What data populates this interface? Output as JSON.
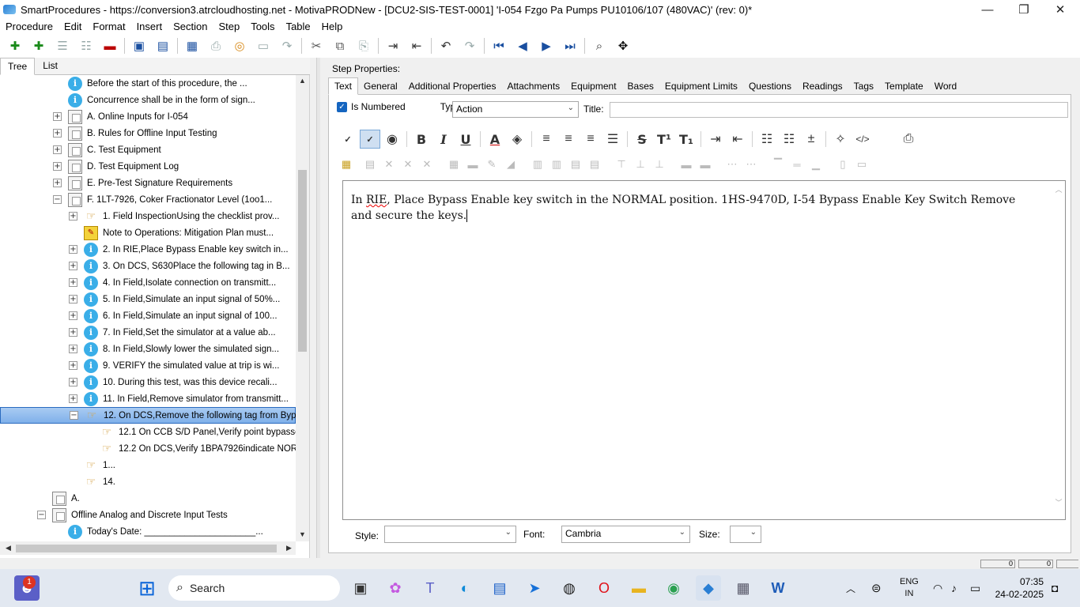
{
  "window": {
    "title": "SmartProcedures - https://conversion3.atrcloudhosting.net - MotivaPRODNew - [DCU2-SIS-TEST-0001] 'I-054 Fzgo Pa Pumps PU10106/107 (480VAC)' (rev: 0)*",
    "minimize": "—",
    "maximize": "❐",
    "close": "✕"
  },
  "menu": [
    "Procedure",
    "Edit",
    "Format",
    "Insert",
    "Section",
    "Step",
    "Tools",
    "Table",
    "Help"
  ],
  "toolbar_icons": [
    "add-icon",
    "add-sub-icon",
    "list-icon",
    "list-gray-icon",
    "remove-icon",
    "save-all-icon",
    "save-icon",
    "export-icon",
    "print-icon",
    "link-icon",
    "blank-icon",
    "redo-gray-icon",
    "cut-icon",
    "copy-icon",
    "paste-icon",
    "indent-icon",
    "outdent-icon",
    "undo-icon",
    "redo-icon",
    "first-icon",
    "prev-icon",
    "next-icon",
    "last-icon",
    "find-icon",
    "move-icon"
  ],
  "left": {
    "tabs": [
      "Tree",
      "List"
    ],
    "tree": [
      {
        "expander": "",
        "icon": "info",
        "label": "Before the start of this procedure, the ...",
        "indent": 1
      },
      {
        "expander": "",
        "icon": "info",
        "label": "Concurrence shall be in the form of sign...",
        "indent": 1
      },
      {
        "expander": "+",
        "icon": "doc",
        "label": "A. Online Inputs for I-054",
        "indent": 1
      },
      {
        "expander": "+",
        "icon": "doc",
        "label": "B. Rules for Offline Input Testing",
        "indent": 1
      },
      {
        "expander": "+",
        "icon": "doc",
        "label": "C. Test Equipment",
        "indent": 1
      },
      {
        "expander": "+",
        "icon": "doc",
        "label": "D. Test Equipment Log",
        "indent": 1
      },
      {
        "expander": "+",
        "icon": "doc",
        "label": "E. Pre-Test Signature Requirements",
        "indent": 1
      },
      {
        "expander": "−",
        "icon": "doc",
        "label": "F. 1LT-7926, Coker Fractionator Level (1oo1...",
        "indent": 1
      },
      {
        "expander": "+",
        "icon": "hand",
        "label": "1. Field InspectionUsing the checklist prov...",
        "indent": 2
      },
      {
        "expander": "",
        "icon": "note",
        "label": "Note to Operations: Mitigation Plan must...",
        "indent": 2
      },
      {
        "expander": "+",
        "icon": "info",
        "label": "2. In RIE,Place Bypass Enable key switch in...",
        "indent": 2
      },
      {
        "expander": "+",
        "icon": "info",
        "label": "3. On DCS, S630Place the following tag in B...",
        "indent": 2
      },
      {
        "expander": "+",
        "icon": "info",
        "label": "4. In Field,Isolate connection on transmitt...",
        "indent": 2
      },
      {
        "expander": "+",
        "icon": "info",
        "label": "5. In Field,Simulate an input signal of 50%...",
        "indent": 2
      },
      {
        "expander": "+",
        "icon": "info",
        "label": "6. In Field,Simulate an input signal of 100...",
        "indent": 2
      },
      {
        "expander": "+",
        "icon": "info",
        "label": "7. In Field,Set the simulator at a value ab...",
        "indent": 2
      },
      {
        "expander": "+",
        "icon": "info",
        "label": "8. In Field,Slowly lower the simulated sign...",
        "indent": 2
      },
      {
        "expander": "+",
        "icon": "info",
        "label": "9. VERIFY the simulated value at trip is wi...",
        "indent": 2
      },
      {
        "expander": "+",
        "icon": "info",
        "label": "10. During this test, was this device recali...",
        "indent": 2
      },
      {
        "expander": "+",
        "icon": "info",
        "label": "11. In Field,Remove simulator from transmitt...",
        "indent": 2
      },
      {
        "expander": "−",
        "icon": "hand",
        "label": "12. On DCS,Remove the following tag from Byp...",
        "indent": 2,
        "selected": true
      },
      {
        "expander": "",
        "icon": "hand",
        "label": "12.1 On  CCB S/D Panel,Verify  point bypassed...",
        "indent": 3
      },
      {
        "expander": "",
        "icon": "hand",
        "label": "12.2 On DCS,Verify 1BPA7926indicate NORMAL",
        "indent": 3
      },
      {
        "expander": "",
        "icon": "hand",
        "label": "1...",
        "indent": 2
      },
      {
        "expander": "",
        "icon": "hand",
        "label": "14.",
        "indent": 2
      },
      {
        "expander": "",
        "icon": "doc",
        "label": "A.",
        "indent": 0
      },
      {
        "expander": "−",
        "icon": "doc",
        "label": "Offline Analog and Discrete Input Tests",
        "indent": 0
      },
      {
        "expander": "",
        "icon": "info",
        "label": "Today's Date: ______________________...",
        "indent": 1
      }
    ]
  },
  "right": {
    "header": "Step Properties:",
    "tabs": [
      "Text",
      "General",
      "Additional Properties",
      "Attachments",
      "Equipment",
      "Bases",
      "Equipment Limits",
      "Questions",
      "Readings",
      "Tags",
      "Template",
      "Word"
    ],
    "is_numbered_label": "Is Numbered",
    "type_label": "Type:",
    "type_value": "Action",
    "title_label": "Title:",
    "editor": {
      "word1": "In",
      "word2": "RIE",
      "rest": ", Place Bypass Enable key switch in the NORMAL position. 1HS-9470D, I-54 Bypass Enable Key Switch   Remove and secure the keys."
    },
    "style_label": "Style:",
    "style_value": "",
    "font_label": "Font:",
    "font_value": "Cambria",
    "size_label": "Size:",
    "size_value": ""
  },
  "status": [
    "0",
    "0"
  ],
  "taskbar": {
    "search": "Search",
    "notification_badge": "1",
    "lang1": "ENG",
    "lang2": "IN",
    "time": "07:35",
    "date": "24-02-2025"
  }
}
